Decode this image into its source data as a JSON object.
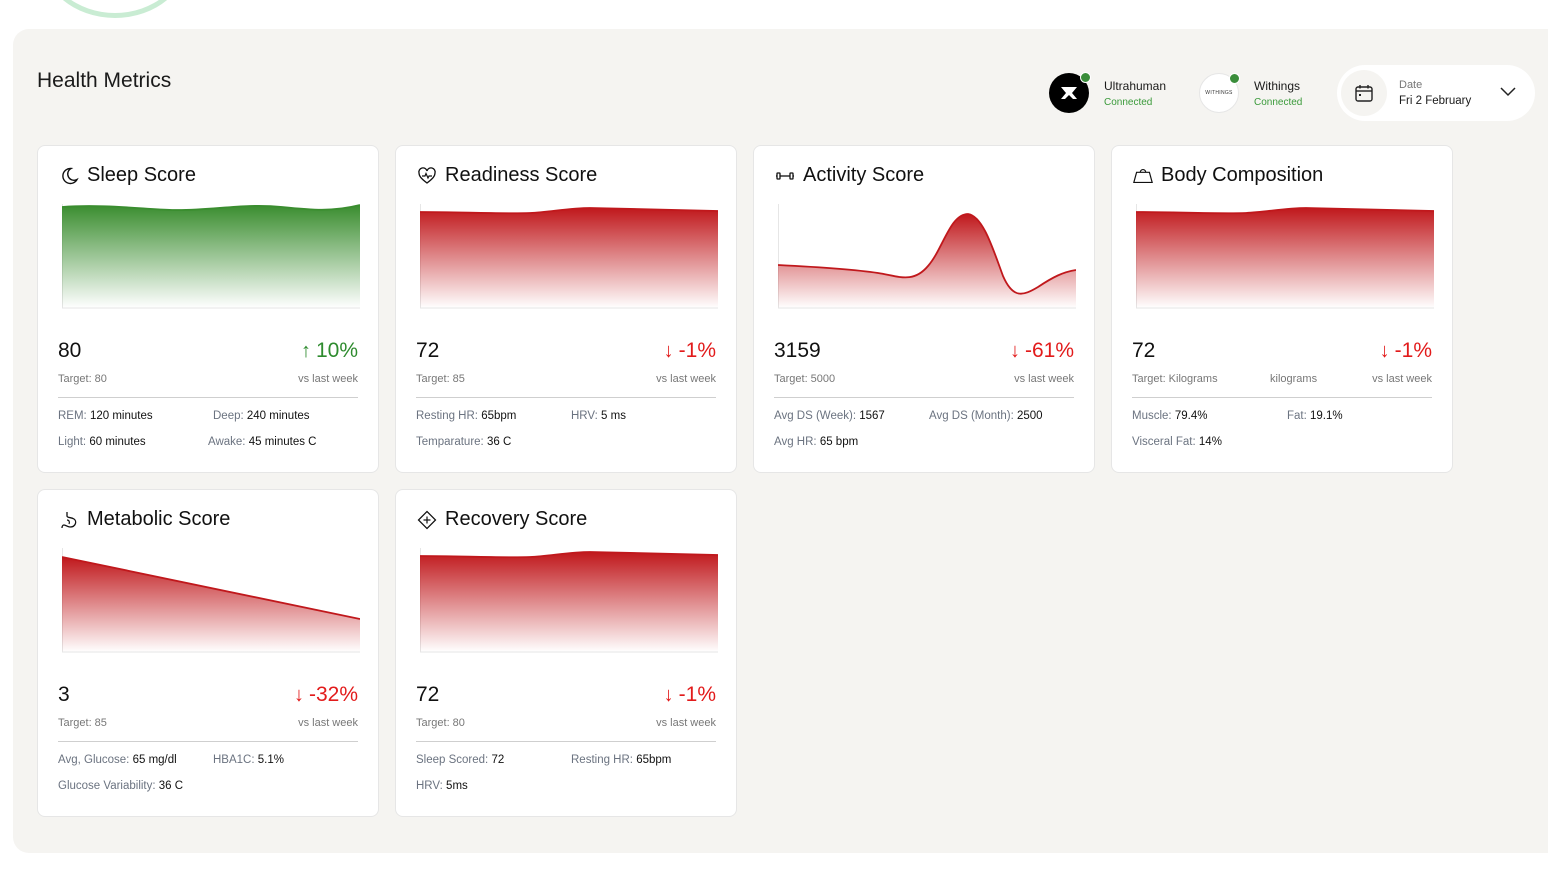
{
  "header": {
    "title": "Health Metrics"
  },
  "devices": [
    {
      "name": "Ultrahuman",
      "status": "Connected",
      "logo_text": ""
    },
    {
      "name": "Withings",
      "status": "Connected",
      "logo_text": "WITHINGS"
    }
  ],
  "date": {
    "label": "Date",
    "value": "Fri 2 February"
  },
  "colors": {
    "green": "#3a8d2f",
    "red": "#c0181c",
    "up": "#2e8b2e",
    "down": "#e21b1b",
    "panel": "#f5f4f1"
  },
  "cards": {
    "sleep": {
      "title": "Sleep Score",
      "icon": "moon-icon",
      "score": "80",
      "direction": "up",
      "arrow": "↑",
      "change": "10%",
      "target": "Target: 80",
      "vs": "vs last week",
      "color": "green",
      "stats": [
        {
          "k": "REM:",
          "v": "120 minutes"
        },
        {
          "k": "Deep:",
          "v": "240 minutes"
        },
        {
          "k": "Light:",
          "v": "60 minutes"
        },
        {
          "k": "Awake:",
          "v": "45 minutes C"
        }
      ]
    },
    "readiness": {
      "title": "Readiness Score",
      "icon": "heart-pulse-icon",
      "score": "72",
      "direction": "down",
      "arrow": "↓",
      "change": "-1%",
      "target": "Target: 85",
      "vs": "vs last week",
      "color": "red",
      "stats": [
        {
          "k": "Resting HR:",
          "v": "65bpm"
        },
        {
          "k": "HRV:",
          "v": "5 ms"
        },
        {
          "k": "Temparature:",
          "v": "36 C"
        }
      ]
    },
    "activity": {
      "title": "Activity Score",
      "icon": "dumbbell-icon",
      "score": "3159",
      "direction": "down",
      "arrow": "↓",
      "change": "-61%",
      "target": "Target: 5000",
      "vs": "vs last week",
      "color": "red",
      "stats": [
        {
          "k": "Avg DS (Week):",
          "v": "1567"
        },
        {
          "k": "Avg DS (Month):",
          "v": "2500"
        },
        {
          "k": "Avg HR:",
          "v": "65 bpm"
        }
      ]
    },
    "body": {
      "title": "Body Composition",
      "icon": "scale-icon",
      "score": "72",
      "direction": "down",
      "arrow": "↓",
      "change": "-1%",
      "target": "Target: Kilograms",
      "unit": "kilograms",
      "vs": "vs last week",
      "color": "red",
      "stats": [
        {
          "k": "Muscle:",
          "v": "79.4%"
        },
        {
          "k": "Fat:",
          "v": "19.1%"
        },
        {
          "k": "Visceral Fat:",
          "v": "14%"
        }
      ]
    },
    "metabolic": {
      "title": "Metabolic Score",
      "icon": "stomach-icon",
      "score": "3",
      "direction": "down",
      "arrow": "↓",
      "change": "-32%",
      "target": "Target: 85",
      "vs": "vs last week",
      "color": "red",
      "stats": [
        {
          "k": "Avg, Glucose:",
          "v": "65 mg/dl"
        },
        {
          "k": "HBA1C:",
          "v": "5.1%"
        },
        {
          "k": "Glucose Variability:",
          "v": "36 C"
        }
      ]
    },
    "recovery": {
      "title": "Recovery Score",
      "icon": "recovery-diamond-icon",
      "score": "72",
      "direction": "down",
      "arrow": "↓",
      "change": "-1%",
      "target": "Target: 80",
      "vs": "vs last week",
      "color": "red",
      "stats": [
        {
          "k": "Sleep Scored:",
          "v": "72"
        },
        {
          "k": "Resting HR:",
          "v": "65bpm"
        },
        {
          "k": "HRV:",
          "v": "5ms"
        }
      ]
    }
  }
}
